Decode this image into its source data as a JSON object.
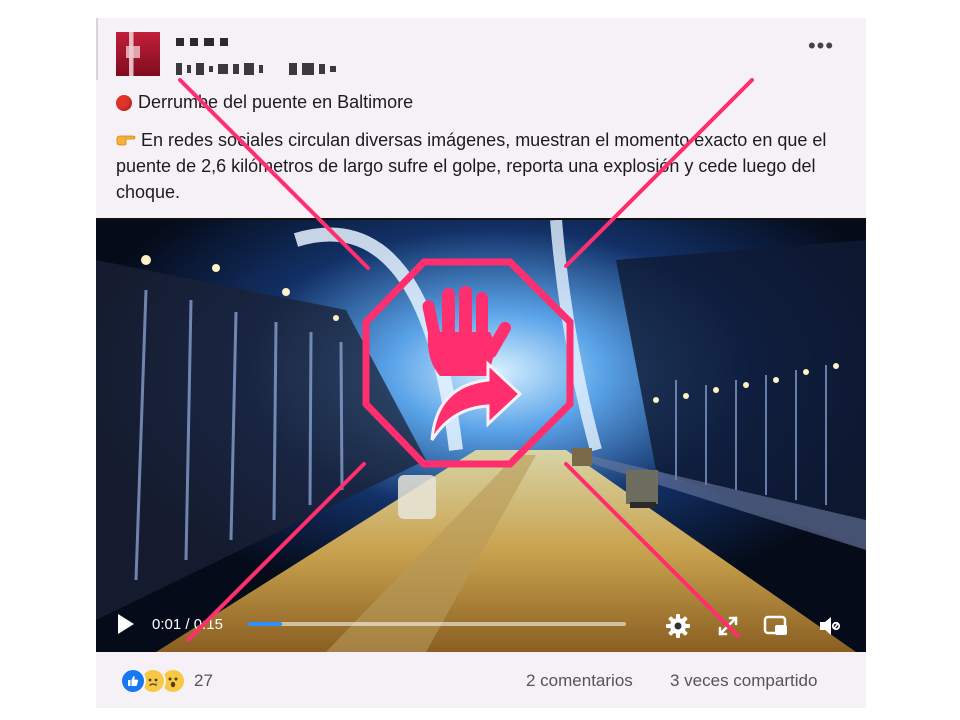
{
  "post": {
    "more_label": "•••",
    "title": "Derrumbe del puente en Baltimore",
    "title_icon": "red-circle-emoji",
    "body_icon": "pointing-hand-emoji",
    "body": "En redes sociales circulan diversas imágenes, muestran el momento exacto en que el puente de 2,6 kilómetros de largo sufre el golpe, reporta una explosión y cede luego del choque."
  },
  "video": {
    "current_time": "0:01",
    "separator": "/",
    "duration": "0:15",
    "progress": 0.09,
    "icons": [
      "play-icon",
      "settings-gear-icon",
      "fullscreen-icon",
      "picture-in-picture-icon",
      "volume-icon"
    ]
  },
  "footer": {
    "reaction_icons": [
      "like-reaction-icon",
      "sad-reaction-icon",
      "wow-reaction-icon"
    ],
    "reaction_count": "27",
    "comments": "2 comentarios",
    "shares": "3 veces compartido"
  },
  "overlay": {
    "stamp_color": "#ff2e6e",
    "stamp_icon": "hand-stop-share-icon"
  }
}
